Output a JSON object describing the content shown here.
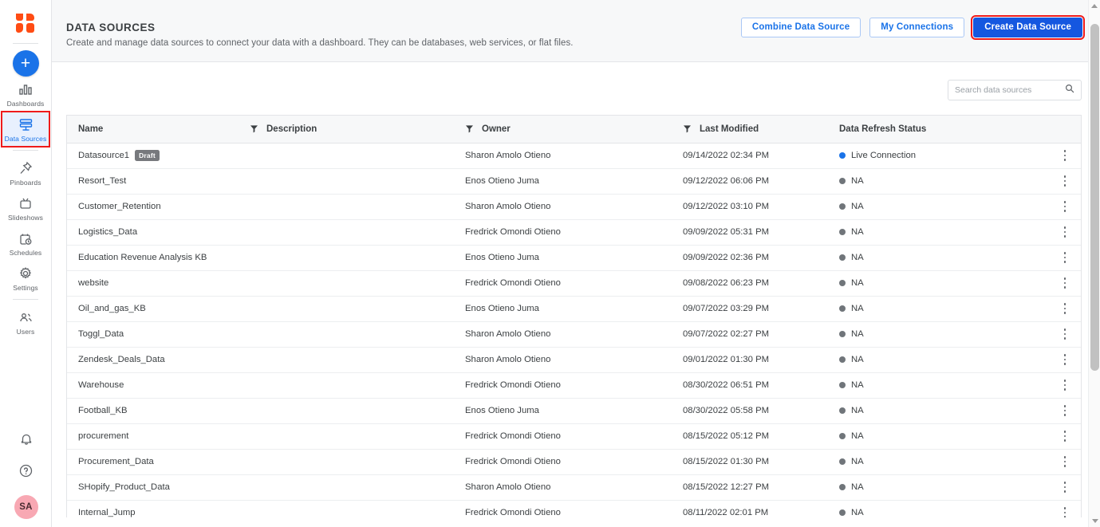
{
  "sidebar": {
    "logo_name": "app-logo",
    "create_button_label": "+",
    "items": [
      {
        "label": "Dashboards",
        "icon": "bar-chart-icon",
        "active": false
      },
      {
        "label": "Data Sources",
        "icon": "database-stack-icon",
        "active": true
      },
      {
        "label": "Pinboards",
        "icon": "pin-icon",
        "active": false
      },
      {
        "label": "Slideshows",
        "icon": "tv-icon",
        "active": false
      },
      {
        "label": "Schedules",
        "icon": "calendar-clock-icon",
        "active": false
      },
      {
        "label": "Settings",
        "icon": "gear-icon",
        "active": false
      },
      {
        "label": "Users",
        "icon": "users-icon",
        "active": false
      }
    ],
    "bottom": {
      "notifications_icon": "bell-icon",
      "help_icon": "help-circle-icon",
      "avatar_initials": "SA"
    }
  },
  "header": {
    "title": "DATA SOURCES",
    "subtitle": "Create and manage data sources to connect your data with a dashboard. They can be databases, web services, or flat files.",
    "buttons": {
      "combine": "Combine Data Source",
      "connections": "My Connections",
      "create": "Create Data Source"
    }
  },
  "search": {
    "placeholder": "Search data sources",
    "value": "",
    "icon": "search-icon"
  },
  "table": {
    "columns": [
      {
        "label": "Name",
        "filter": false
      },
      {
        "label": "Description",
        "filter": true
      },
      {
        "label": "Owner",
        "filter": true
      },
      {
        "label": "Last Modified",
        "filter": true
      },
      {
        "label": "Data Refresh Status",
        "filter": false
      }
    ],
    "status_colors": {
      "live": "#1a73e8",
      "na": "#70757a"
    },
    "rows": [
      {
        "name": "Datasource1",
        "badge": "Draft",
        "description": "",
        "owner": "Sharon Amolo Otieno",
        "modified": "09/14/2022 02:34 PM",
        "status": "Live Connection",
        "status_type": "live"
      },
      {
        "name": "Resort_Test",
        "badge": "",
        "description": "",
        "owner": "Enos Otieno Juma",
        "modified": "09/12/2022 06:06 PM",
        "status": "NA",
        "status_type": "na"
      },
      {
        "name": "Customer_Retention",
        "badge": "",
        "description": "",
        "owner": "Sharon Amolo Otieno",
        "modified": "09/12/2022 03:10 PM",
        "status": "NA",
        "status_type": "na"
      },
      {
        "name": "Logistics_Data",
        "badge": "",
        "description": "",
        "owner": "Fredrick Omondi Otieno",
        "modified": "09/09/2022 05:31 PM",
        "status": "NA",
        "status_type": "na"
      },
      {
        "name": "Education Revenue Analysis KB",
        "badge": "",
        "description": "",
        "owner": "Enos Otieno Juma",
        "modified": "09/09/2022 02:36 PM",
        "status": "NA",
        "status_type": "na"
      },
      {
        "name": "website",
        "badge": "",
        "description": "",
        "owner": "Fredrick Omondi Otieno",
        "modified": "09/08/2022 06:23 PM",
        "status": "NA",
        "status_type": "na"
      },
      {
        "name": "Oil_and_gas_KB",
        "badge": "",
        "description": "",
        "owner": "Enos Otieno Juma",
        "modified": "09/07/2022 03:29 PM",
        "status": "NA",
        "status_type": "na"
      },
      {
        "name": "Toggl_Data",
        "badge": "",
        "description": "",
        "owner": "Sharon Amolo Otieno",
        "modified": "09/07/2022 02:27 PM",
        "status": "NA",
        "status_type": "na"
      },
      {
        "name": "Zendesk_Deals_Data",
        "badge": "",
        "description": "",
        "owner": "Sharon Amolo Otieno",
        "modified": "09/01/2022 01:30 PM",
        "status": "NA",
        "status_type": "na"
      },
      {
        "name": "Warehouse",
        "badge": "",
        "description": "",
        "owner": "Fredrick Omondi Otieno",
        "modified": "08/30/2022 06:51 PM",
        "status": "NA",
        "status_type": "na"
      },
      {
        "name": "Football_KB",
        "badge": "",
        "description": "",
        "owner": "Enos Otieno Juma",
        "modified": "08/30/2022 05:58 PM",
        "status": "NA",
        "status_type": "na"
      },
      {
        "name": "procurement",
        "badge": "",
        "description": "",
        "owner": "Fredrick Omondi Otieno",
        "modified": "08/15/2022 05:12 PM",
        "status": "NA",
        "status_type": "na"
      },
      {
        "name": "Procurement_Data",
        "badge": "",
        "description": "",
        "owner": "Fredrick Omondi Otieno",
        "modified": "08/15/2022 01:30 PM",
        "status": "NA",
        "status_type": "na"
      },
      {
        "name": "SHopify_Product_Data",
        "badge": "",
        "description": "",
        "owner": "Sharon Amolo Otieno",
        "modified": "08/15/2022 12:27 PM",
        "status": "NA",
        "status_type": "na"
      },
      {
        "name": "Internal_Jump",
        "badge": "",
        "description": "",
        "owner": "Fredrick Omondi Otieno",
        "modified": "08/11/2022 02:01 PM",
        "status": "NA",
        "status_type": "na"
      }
    ],
    "row_action_icon": "kebab-menu-icon"
  },
  "highlight_color": "#ef1b1b"
}
